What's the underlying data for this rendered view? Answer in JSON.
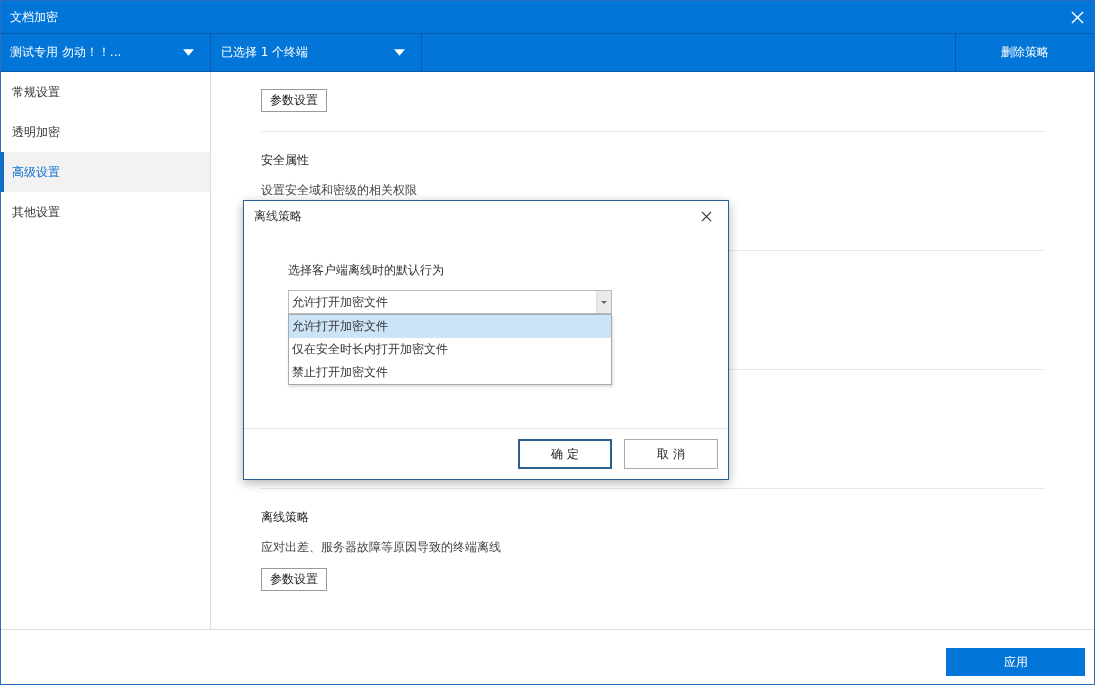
{
  "window": {
    "title": "文档加密"
  },
  "toolbar": {
    "policy_dropdown": "测试专用 勿动！！...",
    "terminal_dropdown": "已选择 1 个终端",
    "delete_button": "删除策略"
  },
  "sidebar": {
    "items": [
      {
        "label": "常规设置",
        "selected": false
      },
      {
        "label": "透明加密",
        "selected": false
      },
      {
        "label": "高级设置",
        "selected": true
      },
      {
        "label": "其他设置",
        "selected": false
      }
    ]
  },
  "sections": [
    {
      "button": "参数设置"
    },
    {
      "title": "安全属性",
      "description": "设置安全域和密级的相关权限"
    },
    {
      "title": "离线策略",
      "description": "应对出差、服务器故障等原因导致的终端离线",
      "button": "参数设置"
    }
  ],
  "footer": {
    "apply_button": "应用"
  },
  "dialog": {
    "title": "离线策略",
    "prompt": "选择客户端离线时的默认行为",
    "select_value": "允许打开加密文件",
    "options": [
      {
        "label": "允许打开加密文件",
        "selected": true
      },
      {
        "label": "仅在安全时长内打开加密文件",
        "selected": false
      },
      {
        "label": "禁止打开加密文件",
        "selected": false
      }
    ],
    "buttons": [
      {
        "label": "确 定",
        "kind": "primary"
      },
      {
        "label": "取 消",
        "kind": "secondary"
      }
    ]
  }
}
